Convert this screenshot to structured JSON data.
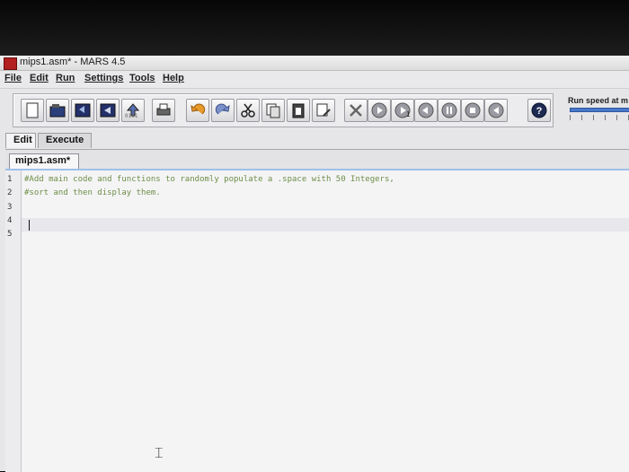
{
  "window": {
    "title": "mips1.asm* - MARS 4.5"
  },
  "menu": [
    "File",
    "Edit",
    "Run",
    "Settings",
    "Tools",
    "Help"
  ],
  "toolbar": {
    "buttons": [
      "new-icon",
      "open-icon",
      "save-icon",
      "save-as-icon",
      "assemble-icon",
      "print-icon",
      "undo-icon",
      "redo-icon",
      "cut-icon",
      "copy-icon",
      "paste-icon",
      "find-replace-icon",
      "clear-icon",
      "run-icon",
      "step-icon",
      "backstep-icon",
      "pause-icon",
      "stop-icon",
      "reset-icon",
      "help-icon"
    ],
    "dump_label": "0101",
    "step_label": "1",
    "run_speed_label": "Run speed at m"
  },
  "tabs": {
    "edit": "Edit",
    "execute": "Execute"
  },
  "editor": {
    "file_tab": "mips1.asm*",
    "line_numbers": [
      "1",
      "2",
      "3",
      "4",
      "5"
    ],
    "lines": [
      "#Add main code and functions to randomly populate a .space with 50 Integers,",
      "#sort and then display them.",
      "",
      "",
      ""
    ]
  },
  "colors": {
    "comment": "#6f8e48",
    "accent": "#4a78c8",
    "app_icon": "#b2201f"
  }
}
